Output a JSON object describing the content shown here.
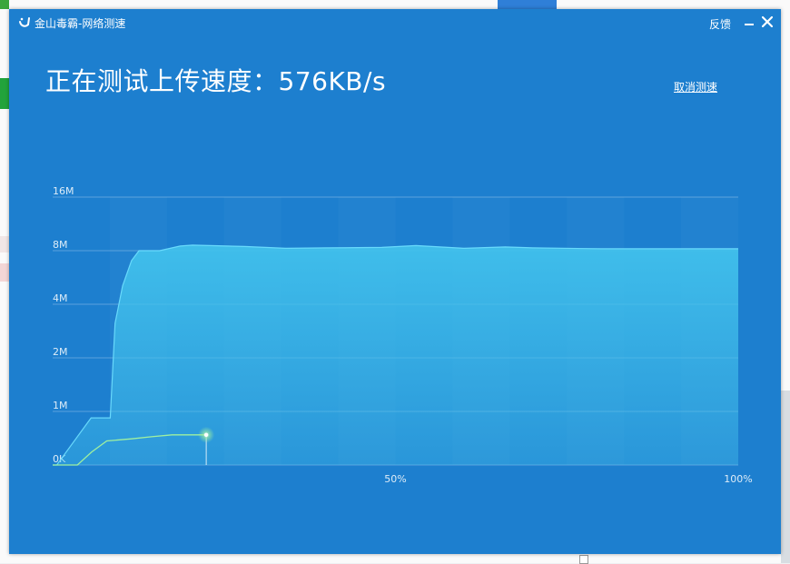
{
  "window": {
    "title": "金山毒霸-网络测速",
    "feedback_label": "反馈",
    "minimize_icon": "minimize-icon",
    "close_icon": "close-icon"
  },
  "status": {
    "headline": "正在测试上传速度：576KB/s",
    "cancel_label": "取消测速"
  },
  "colors": {
    "window_bg": "#1d7fcf",
    "download_fill": "#41c1ec",
    "download_line": "#6fe0ff",
    "upload_line": "#9ff0a0"
  },
  "chart_data": {
    "type": "area",
    "y_scale": "piecewise-log",
    "y_ticks": [
      {
        "label": "16M",
        "value": 16384
      },
      {
        "label": "8M",
        "value": 8192
      },
      {
        "label": "4M",
        "value": 4096
      },
      {
        "label": "2M",
        "value": 2048
      },
      {
        "label": "1M",
        "value": 1024
      },
      {
        "label": "0K",
        "value": 0
      }
    ],
    "x_ticks": [
      {
        "label": "50%",
        "value": 50
      },
      {
        "label": "100%",
        "value": 100
      }
    ],
    "xlim": [
      0,
      100
    ],
    "grid": true,
    "series": [
      {
        "key": "download",
        "points": [
          [
            0,
            0
          ],
          [
            0.6,
            0
          ],
          [
            5.6,
            900
          ],
          [
            8.4,
            900
          ],
          [
            9.1,
            3200
          ],
          [
            10.2,
            5200
          ],
          [
            11.5,
            7200
          ],
          [
            12.6,
            8192
          ],
          [
            15.6,
            8192
          ],
          [
            18.6,
            8700
          ],
          [
            20.4,
            8800
          ],
          [
            28,
            8650
          ],
          [
            34,
            8450
          ],
          [
            40,
            8500
          ],
          [
            48,
            8550
          ],
          [
            53,
            8750
          ],
          [
            60,
            8450
          ],
          [
            66,
            8600
          ],
          [
            70,
            8500
          ],
          [
            80,
            8400
          ],
          [
            90,
            8400
          ],
          [
            100,
            8400
          ]
        ]
      },
      {
        "key": "upload",
        "points": [
          [
            0,
            0
          ],
          [
            3.6,
            0
          ],
          [
            5.7,
            250
          ],
          [
            7.9,
            460
          ],
          [
            11.5,
            500
          ],
          [
            14.4,
            540
          ],
          [
            17.4,
            576
          ],
          [
            22.4,
            576
          ]
        ]
      }
    ]
  }
}
